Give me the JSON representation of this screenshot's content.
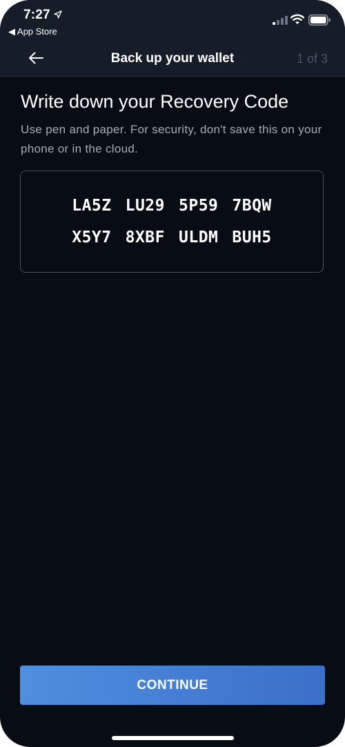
{
  "status_bar": {
    "time": "7:27",
    "back_app": "◀ App Store",
    "icons": [
      "location-arrow-icon",
      "cellular-signal-icon",
      "wifi-icon",
      "battery-icon"
    ]
  },
  "nav": {
    "title": "Back up your wallet",
    "step": "1 of 3",
    "back_icon": "arrow-left-icon"
  },
  "content": {
    "heading": "Write down your Recovery Code",
    "subtext": "Use pen and paper. For security, don't save this on your phone or in the cloud.",
    "recovery_code": {
      "row1": [
        "LA5Z",
        "LU29",
        "5P59",
        "7BQW"
      ],
      "row2": [
        "X5Y7",
        "8XBF",
        "ULDM",
        "BUH5"
      ]
    }
  },
  "footer": {
    "continue_label": "CONTINUE"
  },
  "colors": {
    "background": "#080c13",
    "header": "#151d28",
    "accent": "#4a82d6",
    "muted_text": "#a7adb6"
  }
}
